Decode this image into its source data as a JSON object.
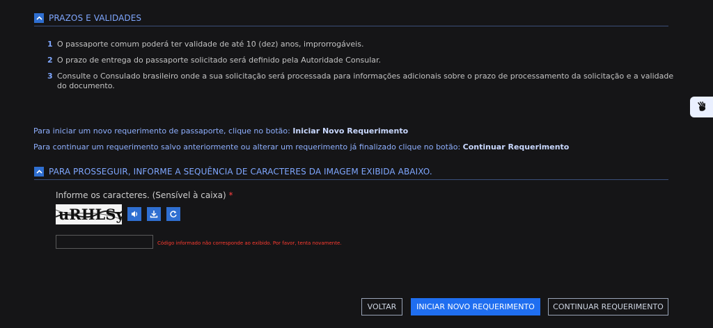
{
  "prazos": {
    "title": "PRAZOS E VALIDADES",
    "items": [
      {
        "num": "1",
        "text": "O passaporte comum poderá ter validade de até 10 (dez) anos, improrrogáveis."
      },
      {
        "num": "2",
        "text": "O prazo de entrega do passaporte solicitado será definido pela Autoridade Consular."
      },
      {
        "num": "3",
        "text": "Consulte o Consulado brasileiro onde a sua solicitação será processada para informações adicionais sobre o prazo de processamento da solicitação e a validade do documento."
      }
    ]
  },
  "info": {
    "line1_prefix": "Para iniciar um novo requerimento de passaporte, clique no botão: ",
    "line1_link": "Iniciar Novo Requerimento",
    "line2_prefix": "Para continuar um requerimento salvo anteriormente ou alterar um requerimento já finalizado clique no botão: ",
    "line2_link": "Continuar Requerimento"
  },
  "captcha": {
    "section_title": "PARA PROSSEGUIR, INFORME A SEQUÊNCIA DE CARACTERES DA IMAGEM EXIBIDA ABAIXO.",
    "label": "Informe os caracteres. (Sensível à caixa)",
    "required_mark": "*",
    "image_text": "uRHLSy",
    "input_value": "",
    "error": "Código informado não corresponde ao exibido. Por favor, tenta novamente.",
    "icons": [
      "audio-icon",
      "download-icon",
      "refresh-icon"
    ]
  },
  "actions": {
    "voltar": "VOLTAR",
    "iniciar": "INICIAR NOVO REQUERIMENTO",
    "continuar": "CONTINUAR REQUERIMENTO"
  },
  "colors": {
    "accent": "#2f6fd1",
    "primary_button": "#1f6ef0",
    "error": "#ff3b30",
    "heading": "#7fa7ff",
    "background": "#151517"
  }
}
